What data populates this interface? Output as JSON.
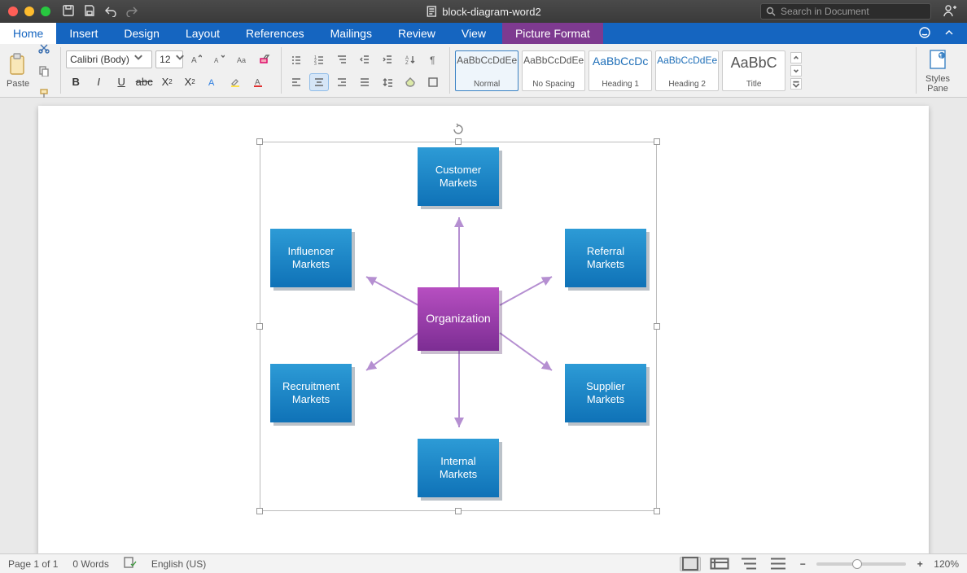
{
  "title": "block-diagram-word2",
  "search_placeholder": "Search in Document",
  "tabs": [
    "Home",
    "Insert",
    "Design",
    "Layout",
    "References",
    "Mailings",
    "Review",
    "View",
    "Picture Format"
  ],
  "ribbon": {
    "paste_label": "Paste",
    "font_name": "Calibri (Body)",
    "font_size": "12",
    "styles": [
      {
        "preview": "AaBbCcDdEe",
        "name": "Normal"
      },
      {
        "preview": "AaBbCcDdEe",
        "name": "No Spacing"
      },
      {
        "preview": "AaBbCcDc",
        "name": "Heading 1"
      },
      {
        "preview": "AaBbCcDdEe",
        "name": "Heading 2"
      },
      {
        "preview": "AaBbC",
        "name": "Title"
      }
    ],
    "styles_pane_label": "Styles Pane"
  },
  "diagram": {
    "center": "Organization",
    "nodes": {
      "top": "Customer Markets",
      "tl": "Influencer Markets",
      "tr": "Referral Markets",
      "bl": "Recruitment Markets",
      "br": "Supplier Markets",
      "bottom": "Internal Markets"
    }
  },
  "status": {
    "page": "Page 1 of 1",
    "words": "0 Words",
    "language": "English (US)",
    "zoom": "120%"
  }
}
